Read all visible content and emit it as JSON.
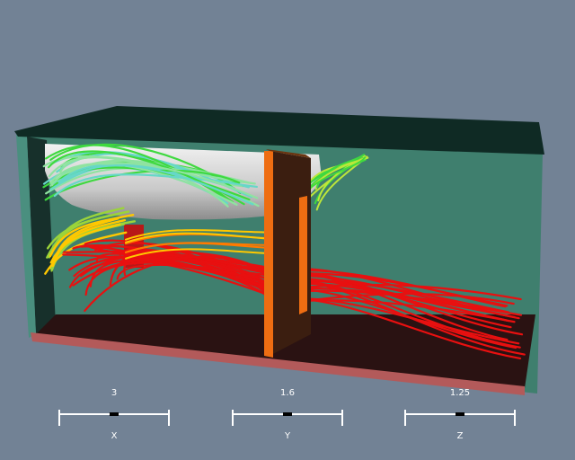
{
  "colors": {
    "background": "#728295",
    "room_wall": "#3f7f6e",
    "room_roof": "#0f2a24",
    "room_floor": "#2a1212",
    "floor_edge": "#b35a5a",
    "partition": "#ee6d12",
    "stream_hot": "#e81010",
    "stream_mid": "#ffc800",
    "stream_cool": "#3fd93f",
    "stream_cold": "#66d7c8"
  },
  "scale_bars": [
    {
      "value": "3",
      "axis": "X"
    },
    {
      "value": "1.6",
      "axis": "Y"
    },
    {
      "value": "1.25",
      "axis": "Z"
    }
  ]
}
